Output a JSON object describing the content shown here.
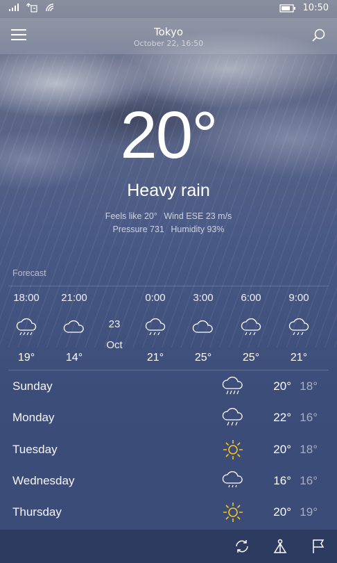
{
  "status_bar": {
    "time": "10:50",
    "icons": [
      "signal-icon",
      "notification-icon",
      "wifi-icon",
      "battery-icon"
    ]
  },
  "header": {
    "city": "Tokyo",
    "datetime": "October 22, 16:50",
    "icons": [
      "menu-icon",
      "search-icon"
    ]
  },
  "current": {
    "temperature": "20°",
    "condition": "Heavy rain",
    "feels_like": "Feels like 20°",
    "wind": "Wind ESE 23 m/s",
    "pressure": "Pressure 731",
    "humidity": "Humidity 93%"
  },
  "forecast_label": "Forecast",
  "hourly": [
    {
      "time": "18:00",
      "icon": "rain-icon",
      "temp": "19°"
    },
    {
      "time": "21:00",
      "icon": "cloud-icon",
      "temp": "14°"
    },
    {
      "time": "0:00",
      "icon": "rain-icon",
      "temp": "21°"
    },
    {
      "time": "3:00",
      "icon": "cloud-icon",
      "temp": "25°"
    },
    {
      "time": "6:00",
      "icon": "rain-icon",
      "temp": "25°"
    },
    {
      "time": "9:00",
      "icon": "rain-icon",
      "temp": "21°"
    }
  ],
  "date_separator": {
    "day": "23",
    "month": "Oct"
  },
  "daily": [
    {
      "day": "Sunday",
      "icon": "rain-icon",
      "high": "20°",
      "low": "18°"
    },
    {
      "day": "Monday",
      "icon": "rain-icon",
      "high": "22°",
      "low": "16°"
    },
    {
      "day": "Tuesday",
      "icon": "sun-icon",
      "high": "20°",
      "low": "18°"
    },
    {
      "day": "Wednesday",
      "icon": "cloud-rain-icon",
      "high": "16°",
      "low": "16°"
    },
    {
      "day": "Thursday",
      "icon": "sun-icon",
      "high": "20°",
      "low": "19°"
    }
  ],
  "bottom_bar": {
    "icons": [
      "refresh-icon",
      "location-icon",
      "flag-icon"
    ]
  },
  "colors": {
    "background": "#3f4f7a",
    "bottom_bar": "#2d3b60",
    "sun": "#f5c518"
  }
}
